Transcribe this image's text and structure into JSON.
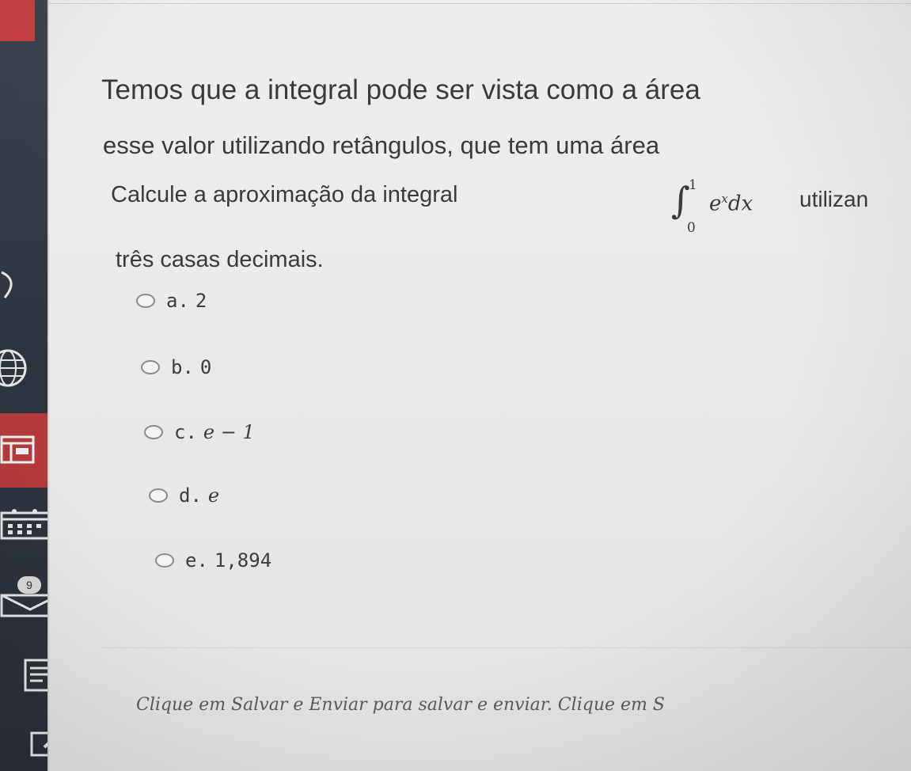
{
  "question": {
    "line1": "Temos que a integral pode ser vista como a área",
    "line2": "esse valor utilizando retângulos, que tem uma área",
    "line3_prefix": "Calcule a aproximação da integral",
    "integral": {
      "lower": "0",
      "upper": "1",
      "integrand": "e",
      "exponent": "x",
      "differential": "dx"
    },
    "line3_suffix": "utilizan",
    "line4": "três casas decimais."
  },
  "options": [
    {
      "letter": "a.",
      "value": "2"
    },
    {
      "letter": "b.",
      "value": "0"
    },
    {
      "letter": "c.",
      "value": "e − 1"
    },
    {
      "letter": "d.",
      "value": "e"
    },
    {
      "letter": "e.",
      "value": "1,894"
    }
  ],
  "footer": {
    "note": "Clique em Salvar e Enviar para salvar e enviar. Clique em S"
  },
  "sidebar": {
    "badge_count": "9",
    "icons": [
      "home-icon",
      "globe-icon",
      "dashboard-icon",
      "calendar-icon",
      "mail-icon",
      "notes-icon",
      "edit-icon"
    ]
  },
  "colors": {
    "sidebar_bg": "#2f353f",
    "accent_red": "#c94145",
    "page_bg": "#eeeeee",
    "text": "#3a3a3a"
  }
}
